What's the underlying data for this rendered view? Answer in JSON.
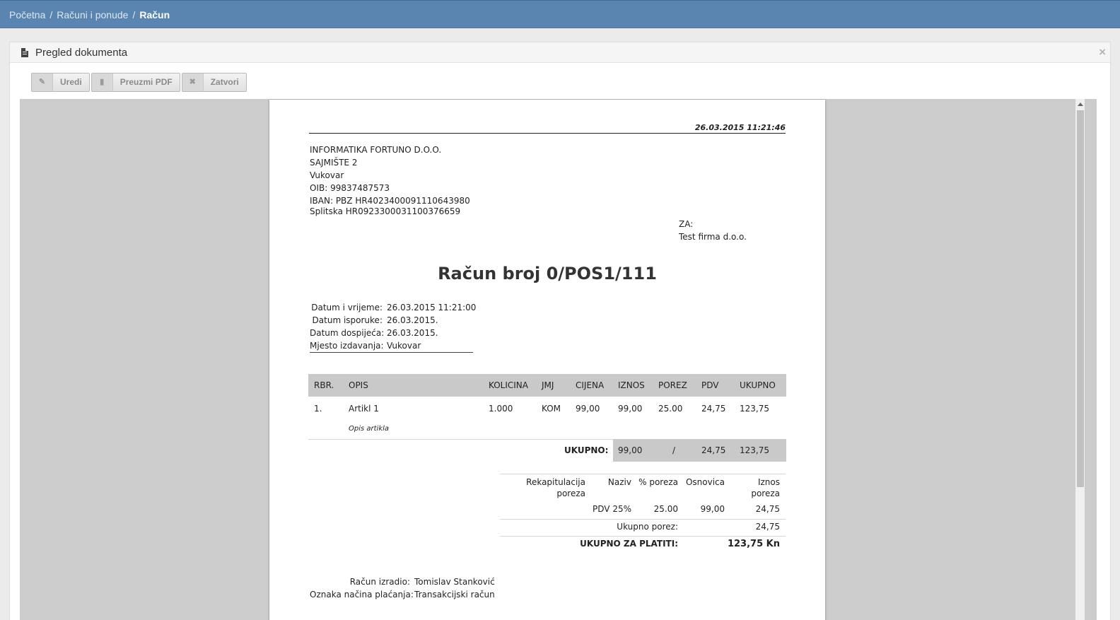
{
  "breadcrumb": {
    "home": "Početna",
    "section": "Računi i ponude",
    "current": "Račun",
    "separator": "/"
  },
  "panel": {
    "title": "Pregled dokumenta",
    "close": "×"
  },
  "toolbar": {
    "edit": "Uredi",
    "download": "Preuzmi PDF",
    "close": "Zatvori"
  },
  "doc": {
    "datetime": "26.03.2015 11:21:46",
    "issuer": {
      "name": "INFORMATIKA FORTUNO D.O.O.",
      "street": "SAJMIŠTE 2",
      "city": "Vukovar",
      "oib": "OIB: 99837487573",
      "iban": "IBAN: PBZ HR4023400091110643980",
      "iban2": "Splitska HR0923300031100376659"
    },
    "to_label": "ZA:",
    "to_name": "Test firma d.o.o.",
    "title": "Račun broj 0/POS1/111",
    "meta": [
      {
        "k": "Datum i vrijeme:",
        "v": "26.03.2015 11:21:00"
      },
      {
        "k": "Datum isporuke:",
        "v": "26.03.2015."
      },
      {
        "k": "Datum dospijeća:",
        "v": "26.03.2015."
      },
      {
        "k": "Mjesto izdavanja:",
        "v": "Vukovar"
      }
    ],
    "columns": [
      "RBR.",
      "OPIS",
      "KOLICINA",
      "JMJ",
      "CIJENA",
      "IZNOS",
      "POREZ",
      "PDV",
      "UKUPNO"
    ],
    "items": [
      {
        "rbr": "1.",
        "opis": "Artikl 1",
        "opis_sub": "Opis artikla",
        "kolicina": "1.000",
        "jmj": "KOM",
        "cijena": "99,00",
        "iznos": "99,00",
        "porez": "25.00",
        "pdv": "24,75",
        "ukupno": "123,75"
      }
    ],
    "totals": {
      "label": "UKUPNO:",
      "iznos": "99,00",
      "porez": "/",
      "pdv": "24,75",
      "ukupno": "123,75"
    },
    "recap": {
      "h_rekap1": "Rekapitulacija",
      "h_rekap2": "poreza",
      "h_naziv": "Naziv",
      "h_posto": "% poreza",
      "h_osnovica": "Osnovica",
      "h_iznos1": "Iznos",
      "h_iznos2": "poreza",
      "row_naziv": "PDV 25%",
      "row_posto": "25.00",
      "row_osnovica": "99,00",
      "row_iznos": "24,75",
      "ukupno_porez_label": "Ukupno porez:",
      "ukupno_porez": "24,75",
      "ukupno_platiti_label": "UKUPNO ZA PLATITI:",
      "ukupno_platiti": "123,75 Kn"
    },
    "footer": [
      {
        "k": "Račun izradio:",
        "v": "Tomislav Stanković"
      },
      {
        "k": "Oznaka načina plaćanja:",
        "v": "Transakcijski račun"
      }
    ]
  }
}
